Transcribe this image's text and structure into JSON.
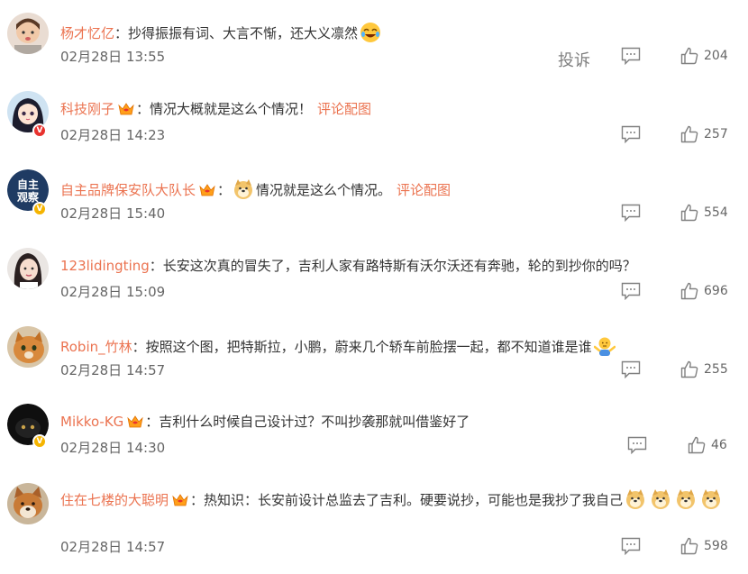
{
  "comments": [
    {
      "username": "杨才忆亿",
      "crown": false,
      "emoji_before_text": false,
      "text": "：抄得振振有词、大言不惭，还大义凛然",
      "trailing_emoji": "laugh-cry",
      "pic_link": "",
      "time": "02月28日 13:55",
      "report": "投诉",
      "likes": "204",
      "avatar": "girl-photo"
    },
    {
      "username": "科技刚子",
      "crown": true,
      "emoji_before_text": false,
      "text": "：情况大概就是这么个情况！",
      "trailing_emoji": "",
      "pic_link": "评论配图",
      "time": "02月28日 14:23",
      "report": "",
      "likes": "257",
      "avatar": "anime-girl"
    },
    {
      "username": "自主品牌保安队大队长",
      "crown": true,
      "emoji_before_text": true,
      "text": "情况就是这么个情况。",
      "trailing_emoji": "",
      "pic_link": "评论配图",
      "time": "02月28日 15:40",
      "report": "",
      "likes": "554",
      "avatar": "navy-logo",
      "avatar_text": "自主观察"
    },
    {
      "username": "123lidingting",
      "crown": false,
      "emoji_before_text": false,
      "text": "：长安这次真的冒失了，吉利人家有路特斯有沃尔沃还有奔驰，轮的到抄你的吗？",
      "trailing_emoji": "",
      "pic_link": "",
      "time": "02月28日 15:09",
      "report": "",
      "likes": "696",
      "avatar": "woman-photo"
    },
    {
      "username": "Robin_竹林",
      "crown": false,
      "emoji_before_text": false,
      "text": "：按照这个图，把特斯拉，小鹏，蔚来几个轿车前脸摆一起，都不知道谁是谁",
      "trailing_emoji": "shrug",
      "pic_link": "",
      "time": "02月28日 14:57",
      "report": "",
      "likes": "255",
      "avatar": "cat-photo"
    },
    {
      "username": "Mikko-KG",
      "crown": true,
      "emoji_before_text": false,
      "text": "：吉利什么时候自己设计过？不叫抄袭那就叫借鉴好了",
      "trailing_emoji": "",
      "pic_link": "",
      "time": "02月28日 14:30",
      "report": "",
      "likes": "46",
      "avatar": "black-cat"
    },
    {
      "username": "住在七楼的大聪明",
      "crown": true,
      "emoji_before_text": false,
      "text": "：热知识：长安前设计总监去了吉利。硬要说抄，可能也是我抄了我自己",
      "trailing_emoji": "doge-x4",
      "pic_link": "",
      "time": "02月28日 14:57",
      "report": "",
      "likes": "598",
      "avatar": "shiba-photo"
    }
  ],
  "colors": {
    "username": "#eb7350",
    "text": "#333333",
    "meta": "#666666",
    "icon": "#808080"
  }
}
